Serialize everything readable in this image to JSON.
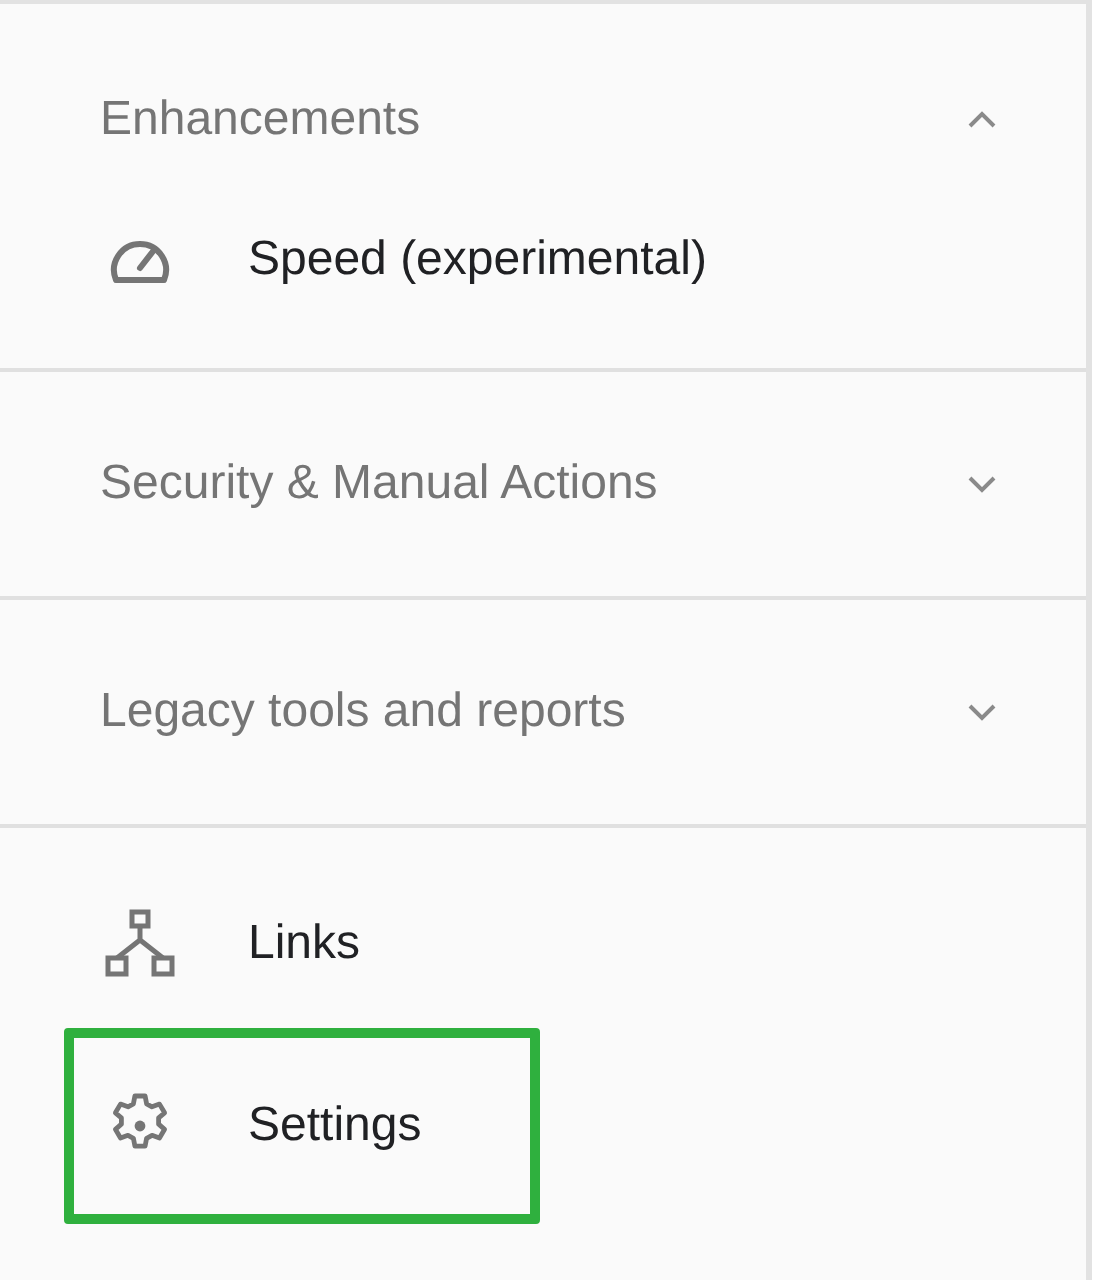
{
  "sections": [
    {
      "title": "Enhancements",
      "expanded": true,
      "items": [
        {
          "label": "Speed (experimental)",
          "highlighted": false
        }
      ]
    },
    {
      "title": "Security & Manual Actions",
      "expanded": false
    },
    {
      "title": "Legacy tools and reports",
      "expanded": false
    }
  ],
  "bottom_items": [
    {
      "label": "Links",
      "highlighted": false
    },
    {
      "label": "Settings",
      "highlighted": true
    }
  ]
}
